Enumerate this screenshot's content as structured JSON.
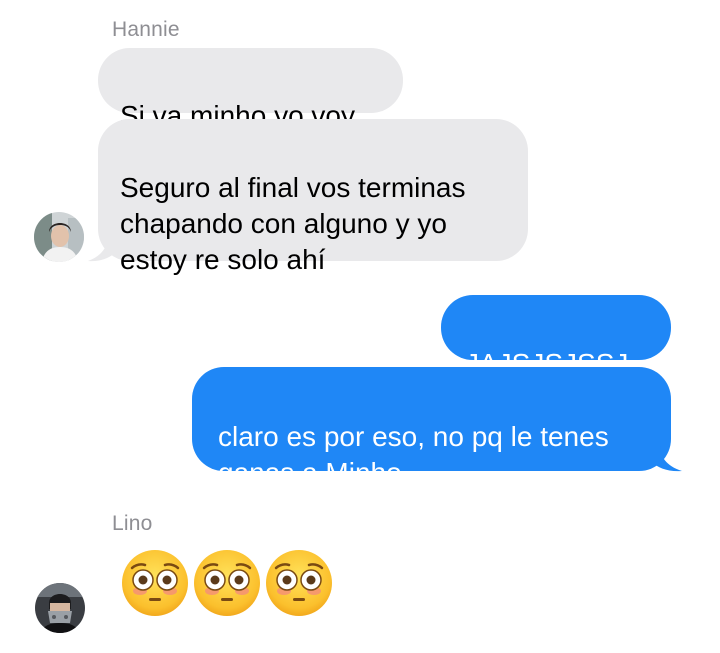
{
  "conversation": {
    "groups": [
      {
        "sender": "Hannie",
        "avatar_icon": "avatar-hannie",
        "messages": [
          "Si va minho yo voy",
          "Seguro al final vos terminas\nchapando con alguno y yo\nestoy re solo ahí"
        ]
      },
      {
        "sender": "",
        "outgoing": true,
        "messages": [
          "JAJSJSJSSJ",
          "claro es por eso, no pq le tenes\nganas a Minho"
        ]
      },
      {
        "sender": "Lino",
        "avatar_icon": "avatar-lino",
        "messages": [
          "😳😳😳"
        ],
        "emoji_icons": [
          "flushed-face-emoji",
          "flushed-face-emoji",
          "flushed-face-emoji"
        ]
      }
    ]
  },
  "colors": {
    "incoming_bubble": "#e9e9eb",
    "outgoing_bubble": "#1f87f6",
    "sender_label": "#8e8e93",
    "background": "#ffffff"
  }
}
